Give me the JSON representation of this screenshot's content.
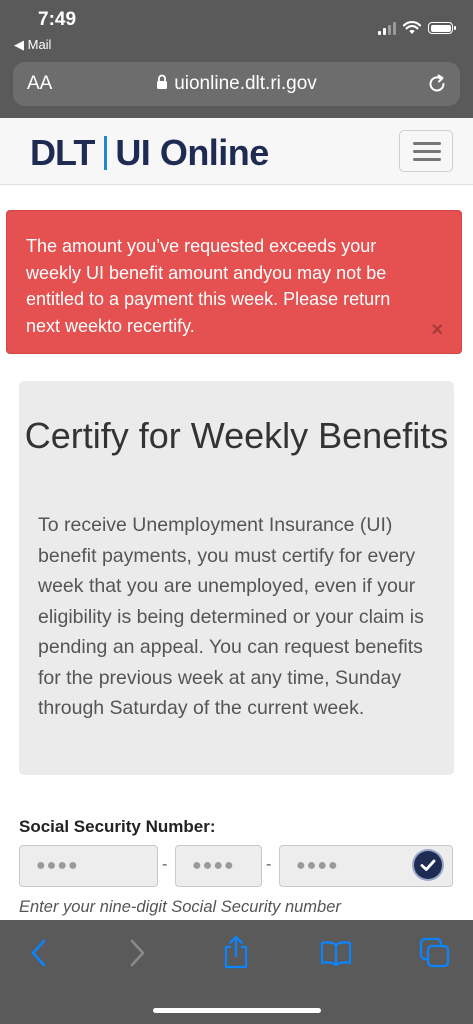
{
  "status_bar": {
    "time": "7:49",
    "back_app": "Mail"
  },
  "safari": {
    "text_size_label": "AA",
    "url": "uionline.dlt.ri.gov"
  },
  "site_header": {
    "logo_dlt": "DLT",
    "logo_ui": "UI Online"
  },
  "alert": {
    "message": "The amount you’ve requested exceeds your weekly UI benefit amount andyou may not be entitled to a payment this week. Please return next weekto recertify.",
    "close_glyph": "×"
  },
  "certify": {
    "title": "Certify for Weekly Benefits",
    "body": "To receive Unemployment Insurance (UI) benefit payments, you must certify for every week that you are unemployed, even if your eligibility is being determined or your claim is pending an appeal. You can request benefits for the previous week at any time, Sunday through Saturday of the current week."
  },
  "ssn": {
    "label": "Social Security Number:",
    "part1_placeholder": "●●●●",
    "part2_placeholder": "●●●●",
    "part3_placeholder": "●●●●",
    "separator": "-",
    "hint": "Enter your nine-digit Social Security number"
  },
  "colors": {
    "chrome": "#5a5a5a",
    "alert_bg": "#e55050",
    "brand_navy": "#1e2b52",
    "brand_blue": "#1e88c9",
    "ios_blue": "#0a84ff"
  }
}
